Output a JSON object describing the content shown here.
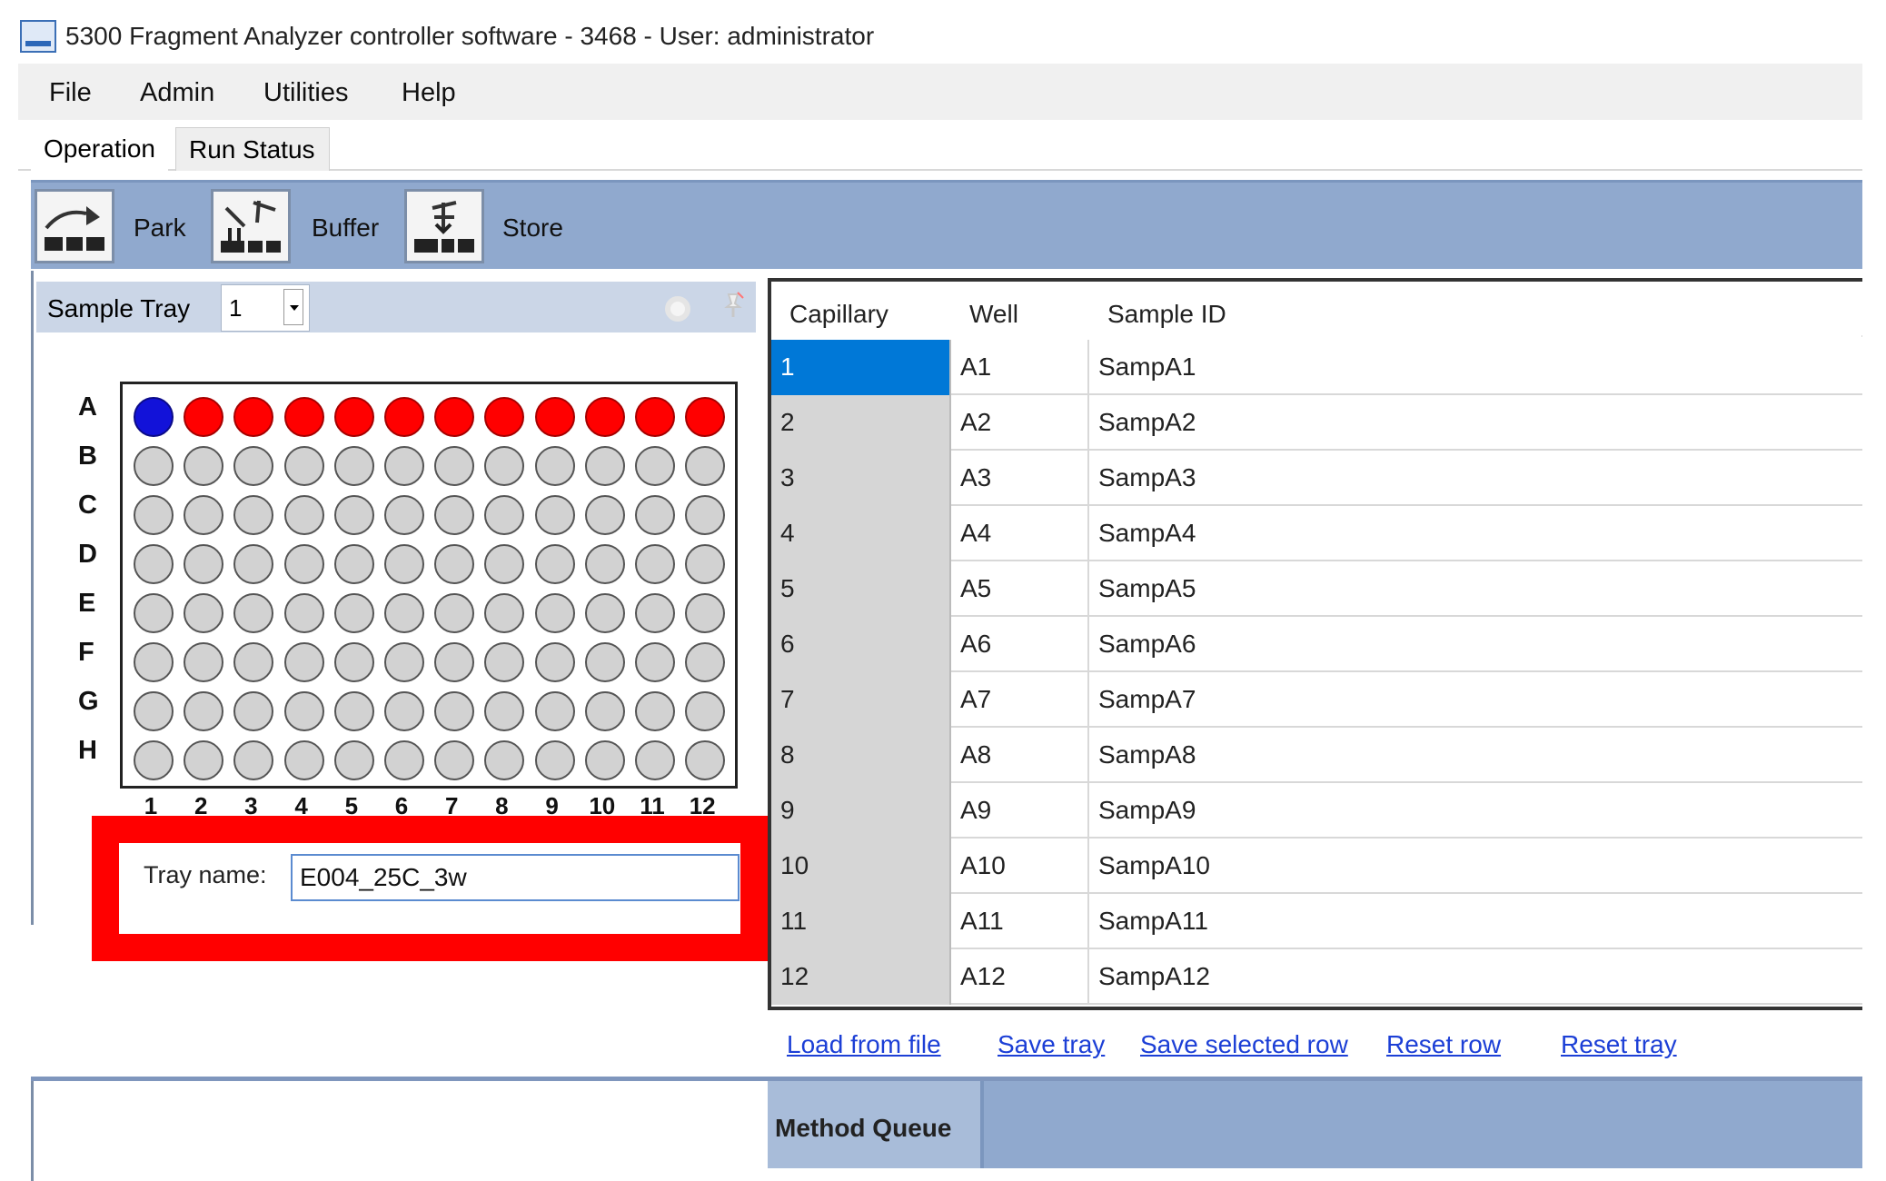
{
  "window": {
    "title": "5300 Fragment Analyzer controller software - 3468 - User: administrator"
  },
  "menu": [
    "File",
    "Admin",
    "Utilities",
    "Help"
  ],
  "tabs": [
    "Operation",
    "Run Status"
  ],
  "toolbar": {
    "buttons": [
      {
        "label": "Park",
        "icon": "park-icon"
      },
      {
        "label": "Buffer",
        "icon": "buffer-icon"
      },
      {
        "label": "Store",
        "icon": "store-icon"
      }
    ]
  },
  "sample_tray": {
    "label": "Sample Tray",
    "selected": "1",
    "rows": [
      "A",
      "B",
      "C",
      "D",
      "E",
      "F",
      "G",
      "H"
    ],
    "columns": [
      "1",
      "2",
      "3",
      "4",
      "5",
      "6",
      "7",
      "8",
      "9",
      "10",
      "11",
      "12"
    ],
    "active_row": "A",
    "selected_well": "A1",
    "colors": {
      "selected": "#1212d9",
      "active": "#ff0000",
      "empty": "#d2d2d2"
    }
  },
  "tray_name": {
    "label": "Tray name:",
    "value": "E004_25C_3w"
  },
  "grid": {
    "headers": [
      "Capillary",
      "Well",
      "Sample ID"
    ],
    "rows": [
      {
        "capillary": "1",
        "well": "A1",
        "sample_id": "SampA1"
      },
      {
        "capillary": "2",
        "well": "A2",
        "sample_id": "SampA2"
      },
      {
        "capillary": "3",
        "well": "A3",
        "sample_id": "SampA3"
      },
      {
        "capillary": "4",
        "well": "A4",
        "sample_id": "SampA4"
      },
      {
        "capillary": "5",
        "well": "A5",
        "sample_id": "SampA5"
      },
      {
        "capillary": "6",
        "well": "A6",
        "sample_id": "SampA6"
      },
      {
        "capillary": "7",
        "well": "A7",
        "sample_id": "SampA7"
      },
      {
        "capillary": "8",
        "well": "A8",
        "sample_id": "SampA8"
      },
      {
        "capillary": "9",
        "well": "A9",
        "sample_id": "SampA9"
      },
      {
        "capillary": "10",
        "well": "A10",
        "sample_id": "SampA10"
      },
      {
        "capillary": "11",
        "well": "A11",
        "sample_id": "SampA11"
      },
      {
        "capillary": "12",
        "well": "A12",
        "sample_id": "SampA12"
      }
    ]
  },
  "links": [
    "Load from file",
    "Save tray",
    "Save selected row",
    "Reset row",
    "Reset tray"
  ],
  "method_queue": {
    "label": "Method Queue"
  },
  "colors": {
    "toolbar": "#90a9ce",
    "selection": "#0078d7",
    "link": "#1c3fd6",
    "highlight_box": "#ff0000"
  }
}
